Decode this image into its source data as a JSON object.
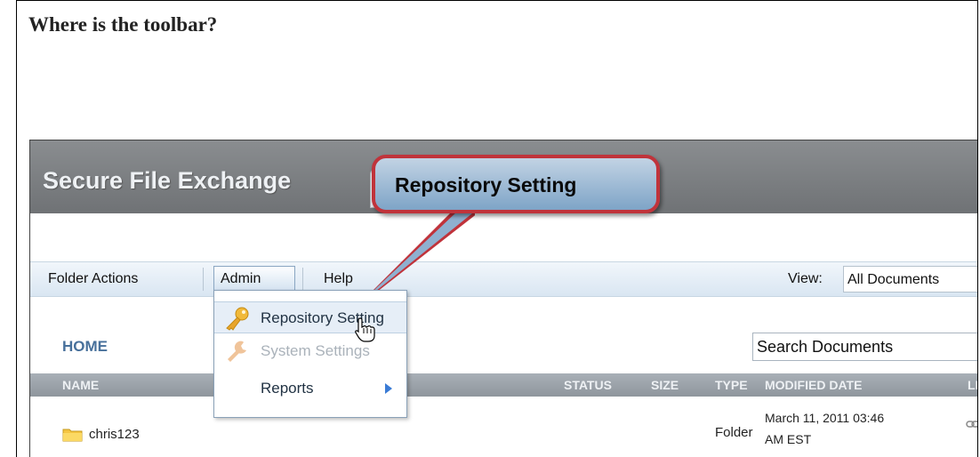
{
  "page": {
    "question": "Where is the toolbar?"
  },
  "app": {
    "title": "Secure File Exchange"
  },
  "callout": {
    "text": "Repository Setting",
    "border_color": "#c0333b",
    "fill_color": "#9bb8d6"
  },
  "toolbar": {
    "items": [
      "Folder Actions",
      "Admin",
      "Help"
    ],
    "view_label": "View:",
    "view_value": "All Documents"
  },
  "admin_menu": {
    "items": [
      {
        "label": "Repository Setting",
        "icon": "key-icon",
        "state": "highlighted"
      },
      {
        "label": "System Settings",
        "icon": "wrench-icon",
        "state": "disabled"
      },
      {
        "label": "Reports",
        "icon": "",
        "state": "submenu"
      }
    ]
  },
  "breadcrumb": {
    "home": "HOME"
  },
  "search": {
    "value": "Search Documents"
  },
  "table": {
    "columns": [
      "NAME",
      "STATUS",
      "SIZE",
      "TYPE",
      "MODIFIED DATE",
      "LIN"
    ],
    "rows": [
      {
        "name": "chris123",
        "status": "",
        "size": "",
        "type": "Folder",
        "modified_line1": "March 11, 2011 03:46",
        "modified_line2": "AM EST",
        "link_icon": "link-icon"
      }
    ]
  },
  "colors": {
    "titlebar": "#7c7f82",
    "toolbar": "#e3ecf5",
    "home_link": "#47709b",
    "header": "#9aa1a8"
  }
}
